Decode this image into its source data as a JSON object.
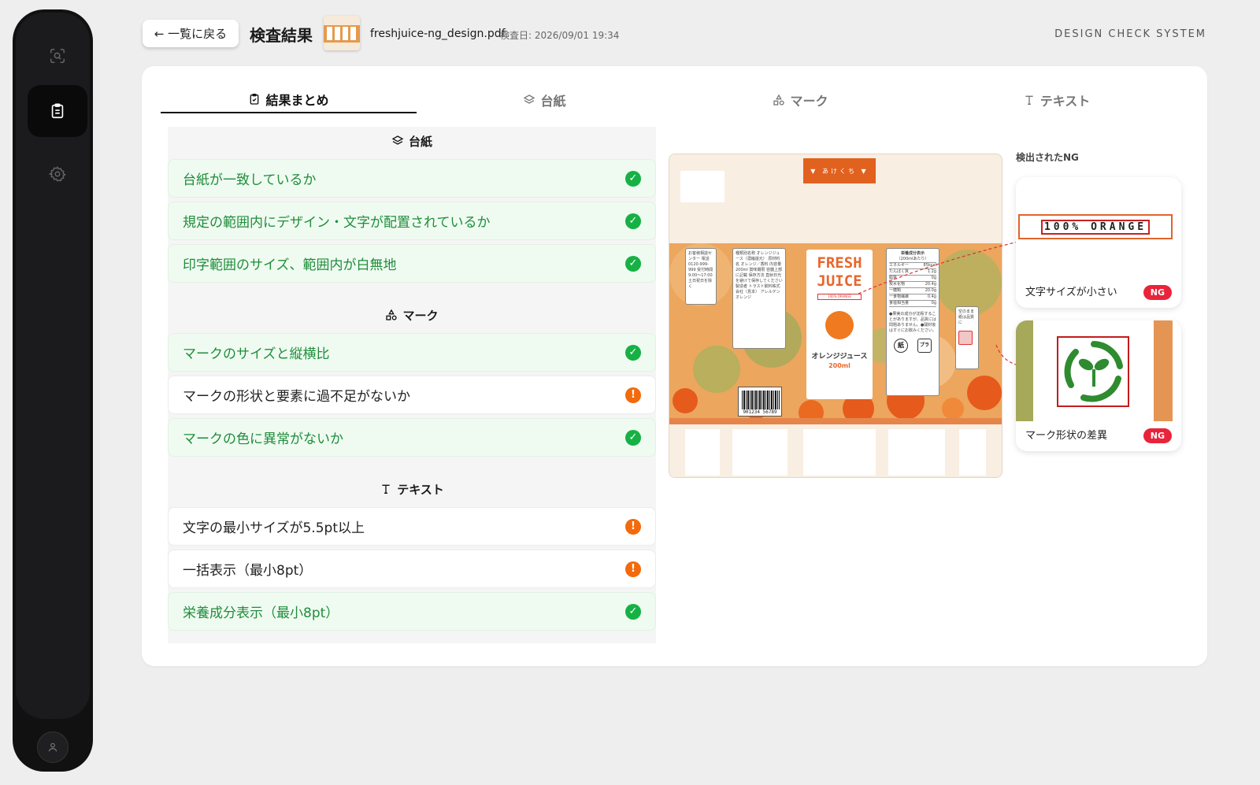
{
  "header": {
    "back_label": "← 一覧に戻る",
    "title": "検査結果",
    "file_name": "freshjuice-ng_design.pdf",
    "check_date": "検査日: 2026/09/01 19:34",
    "brand": "DESIGN CHECK SYSTEM"
  },
  "sidebar": {
    "items": [
      {
        "icon": "scan-search-icon"
      },
      {
        "icon": "clipboard-list-icon",
        "active": true
      },
      {
        "icon": "gear-icon"
      }
    ],
    "avatar_icon": "user-icon"
  },
  "tabs": [
    {
      "label": "結果まとめ",
      "icon": "clipboard-check-icon",
      "active": true
    },
    {
      "label": "台紙",
      "icon": "layers-icon"
    },
    {
      "label": "マーク",
      "icon": "shapes-icon"
    },
    {
      "label": "テキスト",
      "icon": "text-icon"
    }
  ],
  "sections": {
    "daishi": {
      "title": "台紙",
      "items": [
        {
          "label": "台紙が一致しているか",
          "status": "ok"
        },
        {
          "label": "規定の範囲内にデザイン・文字が配置されているか",
          "status": "ok"
        },
        {
          "label": "印字範囲のサイズ、範囲内が白無地",
          "status": "ok"
        }
      ]
    },
    "mark": {
      "title": "マーク",
      "items": [
        {
          "label": "マークのサイズと縦横比",
          "status": "ok"
        },
        {
          "label": "マークの形状と要素に過不足がないか",
          "status": "warn"
        },
        {
          "label": "マークの色に異常がないか",
          "status": "ok"
        }
      ]
    },
    "text": {
      "title": "テキスト",
      "items": [
        {
          "label": "文字の最小サイズが5.5pt以上",
          "status": "warn"
        },
        {
          "label": "一括表示（最小8pt）",
          "status": "warn"
        },
        {
          "label": "栄養成分表示（最小8pt）",
          "status": "ok"
        }
      ]
    }
  },
  "preview": {
    "top_tab": "▼ あけくち ▼",
    "brand_line1": "FRESH",
    "brand_line2": "JUICE",
    "strip_text": "100% ORANGE",
    "product_name": "オレンジジュース",
    "volume": "200ml",
    "barcode": "901234 56789",
    "inquiry": "お客様相談センター 電話 0120-999-999 受付時間 9:00〜17:00 土日祝日を除く",
    "info_panel": "種類別名称 オレンジジュース（濃縮還元） 原材料名 オレンジ／香料 内容量 200ml 賞味期限 容器上部に記載 保存方法 直射日光を避けて保存してください 製造者 トラスト飲料株式会社（見本） アレルゲン オレンジ",
    "nutrition_title": "栄養成分表示",
    "nutrition_sub": "（200mlあたり）",
    "nutrition": [
      {
        "name": "エネルギー",
        "value": "85kcal"
      },
      {
        "name": "たんぱく質",
        "value": "1.2g"
      },
      {
        "name": "脂質",
        "value": "0g"
      },
      {
        "name": "炭水化物",
        "value": "20.4g"
      },
      {
        "name": "一糖類",
        "value": "20.0g"
      },
      {
        "name": "一食物繊維",
        "value": "0.4g"
      },
      {
        "name": "食塩相当量",
        "value": "0g"
      }
    ],
    "nutrition_note": "●果実の成分が沈殿することがありますが、品質には問題ありません。●開封後はすぐにお飲みください。",
    "recycle_paper": "紙",
    "recycle_pla": "プラ",
    "side_note": "空のまま紙は品質に"
  },
  "ng": {
    "title": "検出されたNG",
    "cards": [
      {
        "crop_text": "100% ORANGE",
        "caption": "文字サイズが小さい",
        "badge": "NG"
      },
      {
        "caption": "マーク形状の差異",
        "badge": "NG"
      }
    ]
  },
  "colors": {
    "ok": "#16b144",
    "warn": "#f36a0c",
    "ng": "#e8243a",
    "ok_bg": "#effbf1"
  }
}
